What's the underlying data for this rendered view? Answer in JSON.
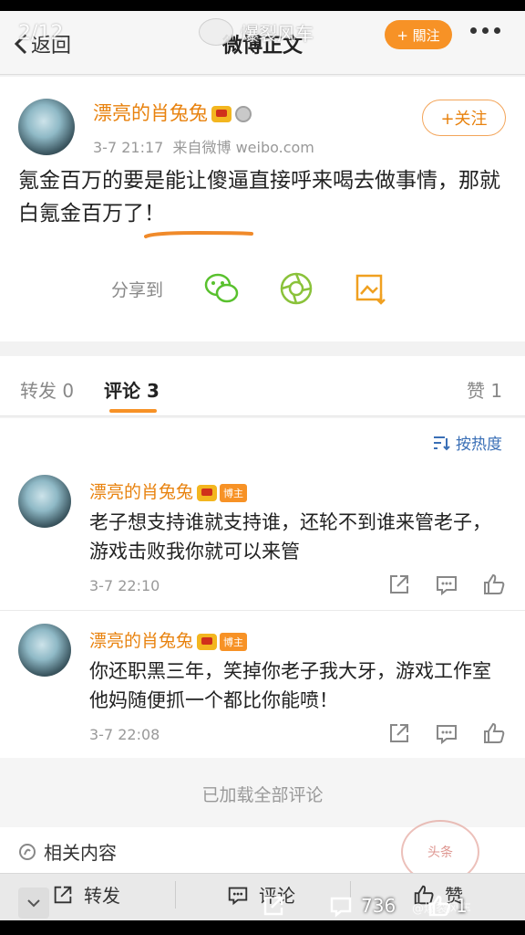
{
  "header": {
    "page_counter": "2/12",
    "back_label": "返回",
    "title": "微博正文",
    "watermark": "爆裂风车",
    "follow_label": "+ 關注"
  },
  "post": {
    "username": "漂亮的肖兔兔",
    "time": "3-7 21:17",
    "source": "来自微博 weibo.com",
    "follow_label": "+关注",
    "text": "氪金百万的要是能让傻逼直接呼来喝去做事情，那就白氪金百万了！",
    "share_label": "分享到"
  },
  "tabs": {
    "repost": "转发 0",
    "comment": "评论 3",
    "like": "赞 1"
  },
  "sort_label": "按热度",
  "comments": [
    {
      "username": "漂亮的肖兔兔",
      "badge": "博主",
      "text": "老子想支持谁就支持谁，还轮不到谁来管老子，游戏击败我你就可以来管",
      "time": "3-7 22:10"
    },
    {
      "username": "漂亮的肖兔兔",
      "badge": "博主",
      "text": "你还职黑三年，笑掉你老子我大牙，游戏工作室他妈随便抓一个都比你能喷！",
      "time": "3-7 22:08"
    }
  ],
  "loaded_all": "已加载全部评论",
  "related_label": "相关内容",
  "stamp_text": "头条",
  "bottom_bar": {
    "repost": "转发",
    "comment": "评论",
    "like": "赞"
  },
  "overlay": {
    "comment_count": "736",
    "like_count": "1",
    "watermark": "@爆裂风车"
  },
  "colors": {
    "accent_orange": "#f79226",
    "username_orange": "#e8820e",
    "link_blue": "#3a6fb6"
  }
}
